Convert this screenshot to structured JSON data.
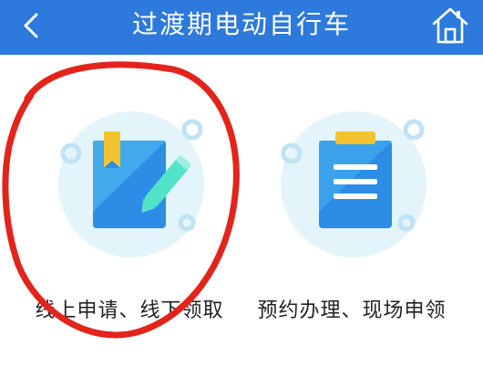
{
  "header": {
    "title": "过渡期电动自行车",
    "back_icon": "chevron-left-icon",
    "home_icon": "home-icon",
    "background_color": "#2d79dc"
  },
  "options": [
    {
      "label": "线上申请、线下领取",
      "icon": "edit-note-icon",
      "highlighted": true
    },
    {
      "label": "预约办理、现场申领",
      "icon": "clipboard-list-icon",
      "highlighted": false
    }
  ],
  "colors": {
    "accent_blue": "#2d8de6",
    "icon_circle": "#e3f4fb",
    "annotation_red": "#e2241c",
    "clip_yellow": "#f4c430"
  }
}
